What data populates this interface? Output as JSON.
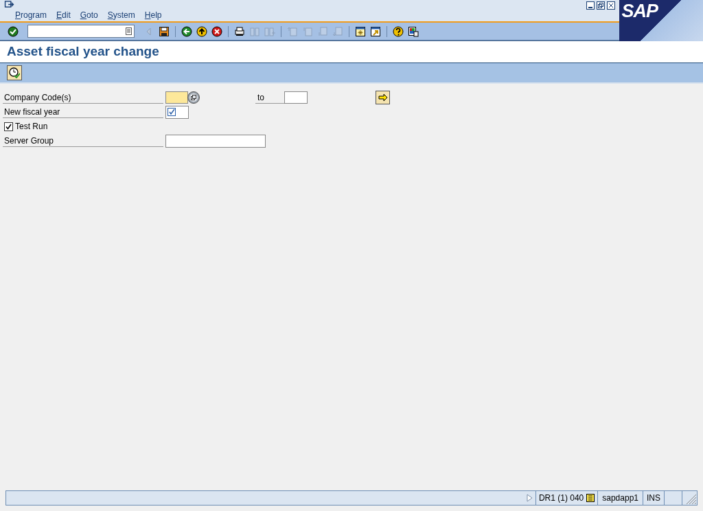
{
  "menu": [
    "Program",
    "Edit",
    "Goto",
    "System",
    "Help"
  ],
  "logo": "SAP",
  "toolbar": [
    {
      "kind": "enter",
      "disabled": false
    },
    {
      "kind": "command_field"
    },
    {
      "kind": "back_small",
      "disabled": true
    },
    {
      "kind": "save",
      "disabled": false
    },
    {
      "kind": "sep"
    },
    {
      "kind": "back",
      "disabled": false
    },
    {
      "kind": "exit",
      "disabled": false
    },
    {
      "kind": "cancel",
      "disabled": false
    },
    {
      "kind": "sep"
    },
    {
      "kind": "print",
      "disabled": false
    },
    {
      "kind": "find",
      "disabled": true
    },
    {
      "kind": "find_next",
      "disabled": true
    },
    {
      "kind": "sep"
    },
    {
      "kind": "first_page",
      "disabled": true
    },
    {
      "kind": "prev_page",
      "disabled": true
    },
    {
      "kind": "next_page",
      "disabled": true
    },
    {
      "kind": "last_page",
      "disabled": true
    },
    {
      "kind": "sep"
    },
    {
      "kind": "new_session",
      "disabled": false
    },
    {
      "kind": "shortcut",
      "disabled": false
    },
    {
      "kind": "sep"
    },
    {
      "kind": "help",
      "disabled": false
    },
    {
      "kind": "layout",
      "disabled": false
    }
  ],
  "title": "Asset fiscal year change",
  "rows": [
    {
      "kind": "range",
      "label": "Company Code(s)",
      "to_label": "to",
      "required": true
    },
    {
      "kind": "field",
      "label": "New fiscal year",
      "required_mark": true
    },
    {
      "kind": "checkbox",
      "label": "Test Run",
      "checked": true
    },
    {
      "kind": "field_wide",
      "label": "Server Group",
      "required_mark": false
    }
  ],
  "status_bar": {
    "system": "DR1 (1) 040",
    "server": "sapdapp1",
    "mode": "INS"
  }
}
